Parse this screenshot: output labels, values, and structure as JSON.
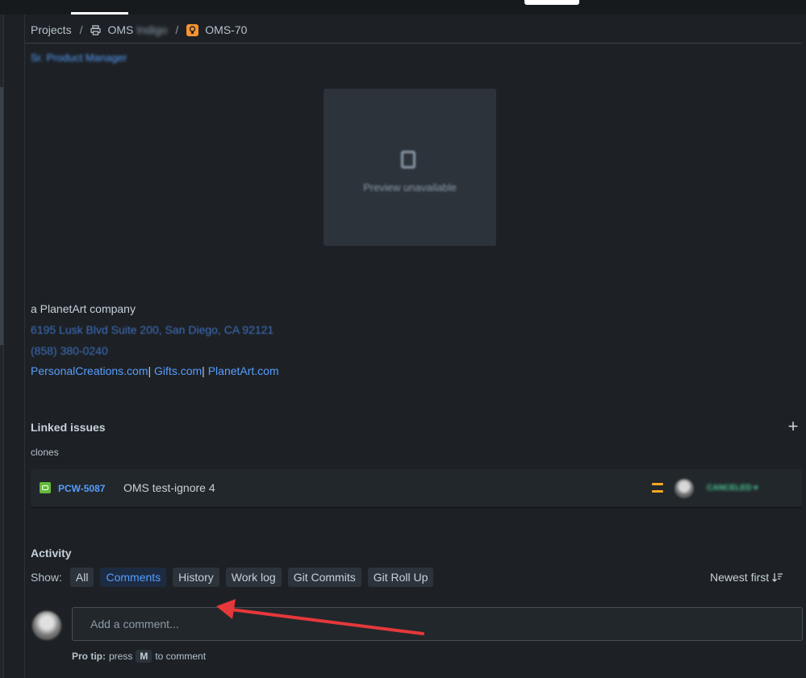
{
  "breadcrumb": {
    "projects": "Projects",
    "separator": "/",
    "project_name": "OMS",
    "project_name_blurred": "Indigo",
    "issue_key": "OMS-70"
  },
  "description": {
    "blurred_title": "Sr. Product Manager",
    "preview_text": "Preview unavailable",
    "signature": {
      "company": "a PlanetArt company",
      "address": "6195 Lusk Blvd Suite 200, San Diego, CA 92121",
      "phone": "(858) 380-0240",
      "links": [
        "PersonalCreations.com",
        "Gifts.com",
        "PlanetArt.com"
      ],
      "link_separator": "|"
    }
  },
  "linked_issues": {
    "title": "Linked issues",
    "relation": "clones",
    "items": [
      {
        "key": "PCW-5087",
        "summary": "OMS test-ignore 4",
        "status": "CANCELED",
        "issue_type_icon": "story-icon",
        "priority_icon": "priority-medium-icon",
        "priority_color": "#F5A623"
      }
    ]
  },
  "activity": {
    "title": "Activity",
    "show_label": "Show:",
    "filters": [
      "All",
      "Comments",
      "History",
      "Work log",
      "Git Commits",
      "Git Roll Up"
    ],
    "selected_filter": "Comments",
    "sort_label": "Newest first",
    "comment_placeholder": "Add a comment...",
    "pro_tip": {
      "label": "Pro tip:",
      "before_key": "press",
      "key": "M",
      "after_key": "to comment"
    }
  },
  "colors": {
    "background": "#1D2125",
    "link": "#579DFF",
    "annotation_arrow": "#E5383B"
  }
}
